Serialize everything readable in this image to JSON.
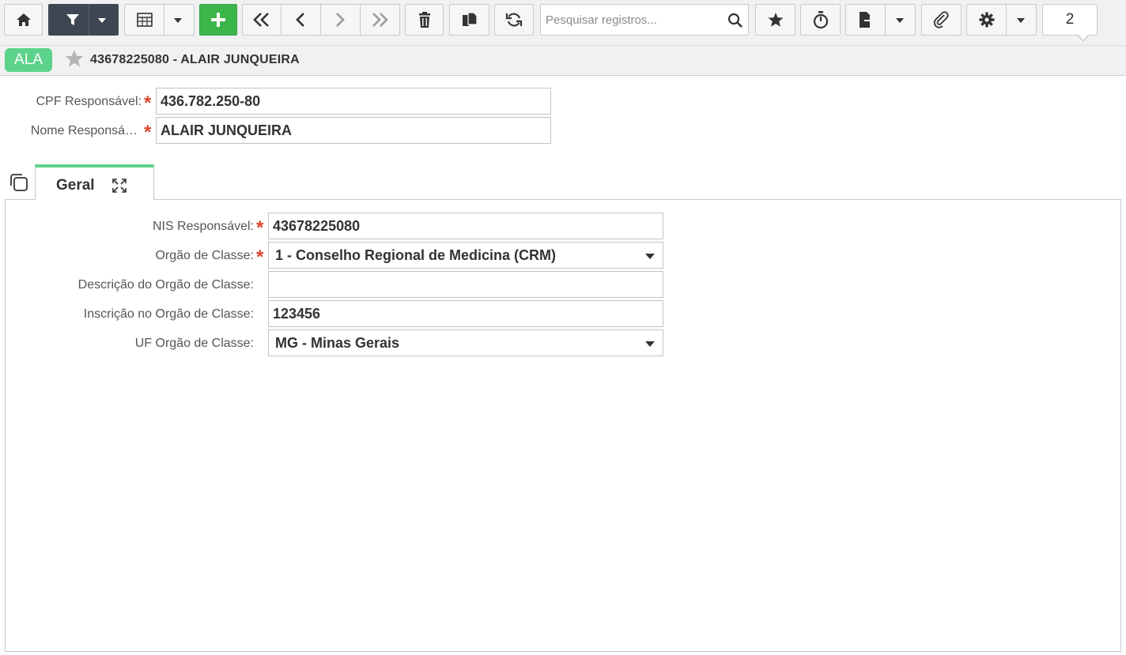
{
  "toolbar": {
    "search_placeholder": "Pesquisar registros...",
    "record_counter": "2",
    "icons": [
      "home-icon",
      "filter-icon",
      "grid-icon",
      "plus-icon",
      "first-icon",
      "prev-icon",
      "next-icon",
      "last-icon",
      "trash-icon",
      "copy-icon",
      "refresh-icon",
      "search-icon",
      "star-icon",
      "timer-icon",
      "export-icon",
      "paperclip-icon",
      "gear-icon"
    ],
    "colors": {
      "filter_bg": "#3e4653",
      "add_bg": "#3cb54a"
    }
  },
  "record": {
    "badge": "ALA",
    "badge_color": "#5dd28a",
    "title": "43678225080 - ALAIR JUNQUEIRA"
  },
  "header_fields": {
    "cpf": {
      "label": "CPF Responsável:",
      "value": "436.782.250-80"
    },
    "nome": {
      "label": "Nome Responsá…",
      "value": "ALAIR JUNQUEIRA"
    },
    "required_mark": "*"
  },
  "tabs": [
    {
      "label": "Geral"
    }
  ],
  "geral": {
    "nis": {
      "label": "NIS Responsável:",
      "value": "43678225080"
    },
    "orgao_classe": {
      "label": "Orgão de Classe:",
      "value": "1 - Conselho Regional de Medicina (CRM)"
    },
    "descricao": {
      "label": "Descrição do Orgão de Classe:",
      "value": ""
    },
    "inscricao": {
      "label": "Inscrição no Orgão de Classe:",
      "value": "123456"
    },
    "uf": {
      "label": "UF Orgão de Classe:",
      "value": "MG - Minas Gerais"
    }
  }
}
